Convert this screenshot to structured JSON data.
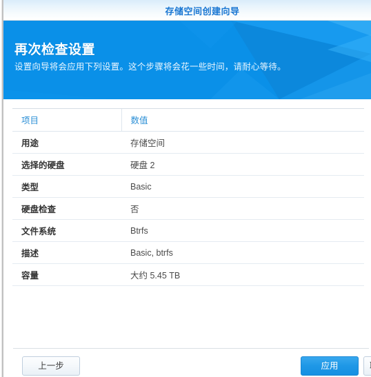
{
  "window": {
    "title": "存储空间创建向导"
  },
  "banner": {
    "heading": "再次检查设置",
    "subheading": "设置向导将会应用下列设置。这个步骤将会花一些时间，请耐心等待。",
    "background_color": "#0a90e8",
    "accent_color": "#1e97e6"
  },
  "table": {
    "headers": [
      "项目",
      "数值"
    ],
    "rows": [
      {
        "item": "用途",
        "value": "存储空间"
      },
      {
        "item": "选择的硬盘",
        "value": "硬盘 2"
      },
      {
        "item": "类型",
        "value": "Basic"
      },
      {
        "item": "硬盘检查",
        "value": "否"
      },
      {
        "item": "文件系统",
        "value": "Btrfs"
      },
      {
        "item": "描述",
        "value": "Basic, btrfs"
      },
      {
        "item": "容量",
        "value": "大约 5.45 TB"
      }
    ]
  },
  "footer": {
    "back_label": "上一步",
    "apply_label": "应用",
    "cutoff_label": "取消"
  }
}
